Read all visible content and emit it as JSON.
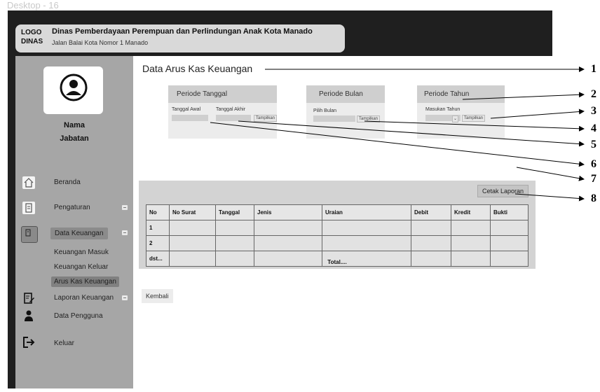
{
  "frame_label": "Desktop - 16",
  "header": {
    "logo": "LOGO DINAS",
    "org_name": "Dinas Pemberdayaan Perempuan dan Perlindungan Anak Kota Manado",
    "org_address": "Jalan Balai Kota Nomor 1 Manado"
  },
  "sidebar": {
    "user_name": "Nama",
    "user_role": "Jabatan",
    "nav": [
      {
        "label": "Beranda",
        "icon": "home-icon"
      },
      {
        "label": "Pengaturan",
        "icon": "document-icon"
      },
      {
        "label": "Data Keuangan",
        "icon": "clipboard-icon"
      },
      {
        "label": "Laporan Keuangan",
        "icon": "edit-document-icon"
      },
      {
        "label": "Data Pengguna",
        "icon": "user-icon"
      },
      {
        "label": "Keluar",
        "icon": "logout-icon"
      }
    ],
    "submenu": [
      "Keuangan Masuk",
      "Keuangan Keluar",
      "Arus Kas Keuangan"
    ]
  },
  "main": {
    "title": "Data Arus Kas Keuangan",
    "periode_tanggal": {
      "title": "Periode Tanggal",
      "start_label": "Tanggal Awal",
      "end_label": "Tanggal Akhir",
      "button": "Tampilkan"
    },
    "periode_bulan": {
      "title": "Periode Bulan",
      "select_label": "Pilih Bulan",
      "button": "Tampilkan"
    },
    "periode_tahun": {
      "title": "Periode Tahun",
      "input_label": "Masukan Tahun",
      "button": "Tampilkan"
    },
    "print_button": "Cetak Laporan",
    "table": {
      "columns": [
        "No",
        "No Surat",
        "Tanggal",
        "Jenis",
        "Uraian",
        "Debit",
        "Kredit",
        "Bukti"
      ],
      "rows": [
        "1",
        "2",
        "dst..."
      ]
    },
    "total_label": "Total....",
    "back_button": "Kembali"
  },
  "callouts": [
    "1",
    "2",
    "3",
    "4",
    "5",
    "6",
    "7",
    "8"
  ]
}
